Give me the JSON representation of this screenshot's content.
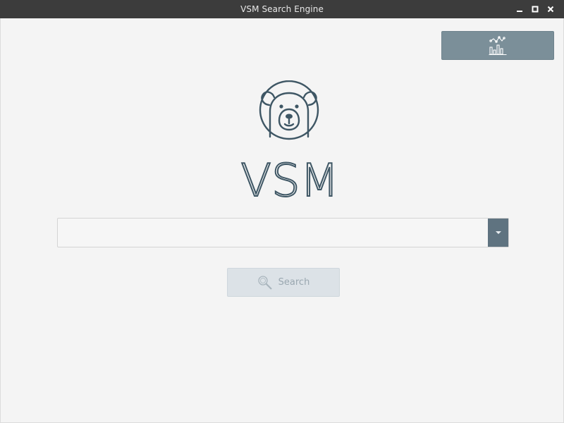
{
  "window": {
    "title": "VSM Search Engine",
    "controls": [
      "minimize-icon",
      "maximize-icon",
      "close-icon"
    ]
  },
  "toolbar": {
    "stats_icon": "bar-chart-icon"
  },
  "logo": {
    "icon": "bear-icon",
    "text": "VSM"
  },
  "search": {
    "query_value": "",
    "placeholder": "",
    "dropdown_icon": "chevron-down-icon",
    "button_label": "Search",
    "button_icon": "magnifier-icon"
  },
  "colors": {
    "brand": "#3e5664",
    "accent_button": "#7b8f99",
    "disabled_button": "#dce2e7"
  }
}
